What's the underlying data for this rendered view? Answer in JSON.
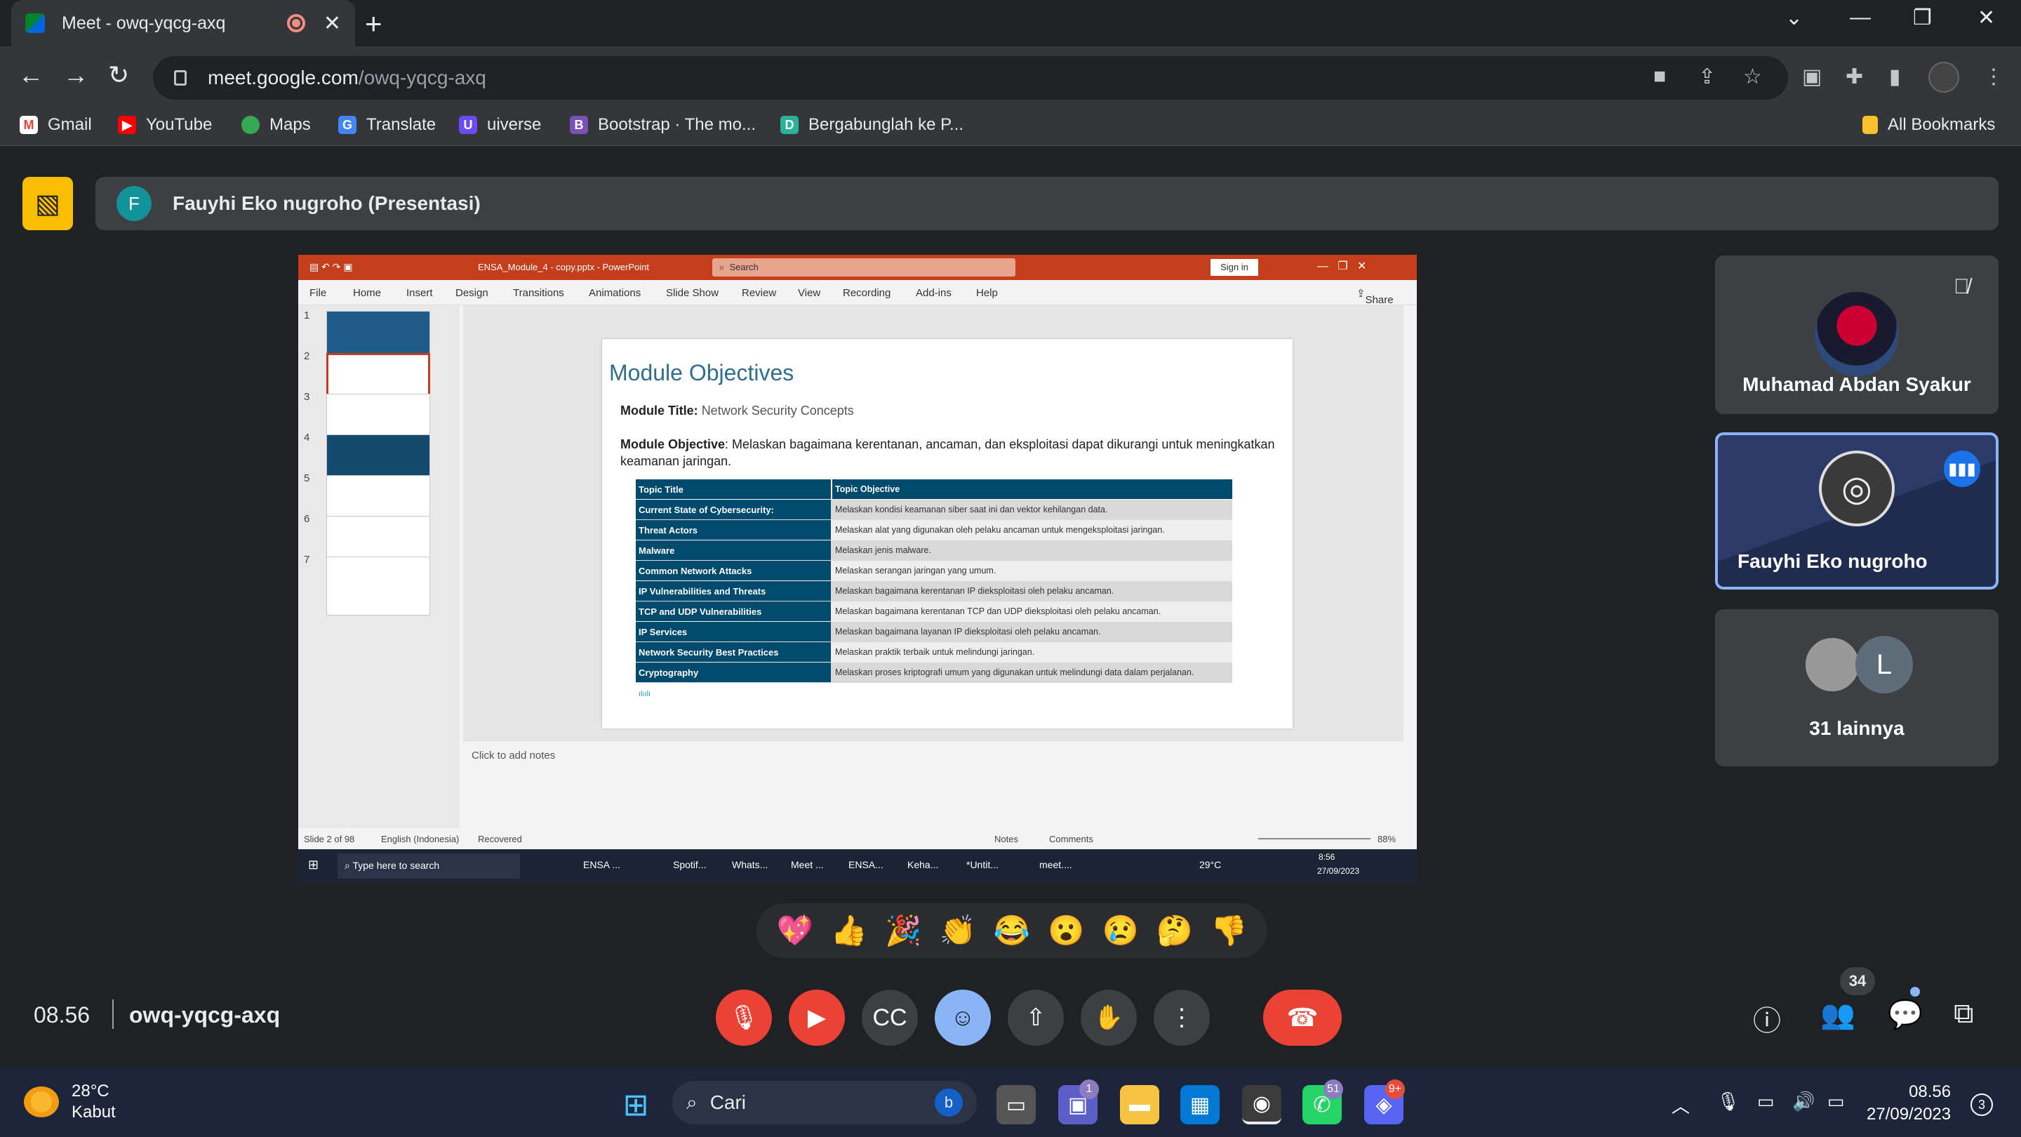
{
  "browser": {
    "tab_title": "Meet - owq-yqcg-axq",
    "url_domain": "meet.google.com",
    "url_path": "/owq-yqcg-axq",
    "bookmarks": [
      "Gmail",
      "YouTube",
      "Maps",
      "Translate",
      "uiverse",
      "Bootstrap · The mo...",
      "Bergabunglah ke P..."
    ],
    "all_bookmarks": "All Bookmarks"
  },
  "meet": {
    "presenter_initial": "F",
    "presenter_label": "Fauyhi Eko nugroho (Presentasi)",
    "time": "08.56",
    "meeting_code": "owq-yqcg-axq",
    "participants_count": "34",
    "reactions": [
      "💖",
      "👍",
      "🎉",
      "👏",
      "😂",
      "😮",
      "😢",
      "🤔",
      "👎"
    ],
    "tiles": [
      {
        "name": "Muhamad Abdan Syakur",
        "muted": true
      },
      {
        "name": "Fauyhi Eko nugroho",
        "speaking": true
      },
      {
        "name": "31 lainnya",
        "initial": "L"
      }
    ]
  },
  "ppt": {
    "file": "ENSA_Module_4 - copy.pptx  -  PowerPoint",
    "search": "Search",
    "sign_in": "Sign in",
    "share": "Share",
    "menu": [
      "File",
      "Home",
      "Insert",
      "Design",
      "Transitions",
      "Animations",
      "Slide Show",
      "Review",
      "View",
      "Recording",
      "Add-ins",
      "Help"
    ],
    "slide_title": "Module Objectives",
    "module_title_label": "Module Title:",
    "module_title": "Network Security Concepts",
    "objective_label": "Module Objective",
    "objective": ": Melaskan bagaimana kerentanan, ancaman, dan eksploitasi dapat dikurangi untuk meningkatkan keamanan jaringan.",
    "table_header": [
      "Topic Title",
      "Topic Objective"
    ],
    "table_rows": [
      [
        "Current State of Cybersecurity:",
        "Melaskan kondisi keamanan siber saat ini dan vektor kehilangan data."
      ],
      [
        "Threat Actors",
        "Melaskan alat yang digunakan oleh pelaku ancaman untuk mengeksploitasi jaringan."
      ],
      [
        "Malware",
        "Melaskan jenis malware."
      ],
      [
        "Common Network Attacks",
        "Melaskan serangan jaringan yang umum."
      ],
      [
        "IP Vulnerabilities and Threats",
        "Melaskan bagaimana kerentanan IP dieksploitasi oleh pelaku ancaman."
      ],
      [
        "TCP and UDP Vulnerabilities",
        "Melaskan bagaimana kerentanan TCP dan UDP dieksploitasi oleh pelaku ancaman."
      ],
      [
        "IP Services",
        "Melaskan bagaimana layanan IP dieksploitasi oleh pelaku ancaman."
      ],
      [
        "Network Security Best Practices",
        "Melaskan praktik terbaik untuk melindungi jaringan."
      ],
      [
        "Cryptography",
        "Melaskan proses kriptografi umum yang digunakan untuk melindungi data dalam perjalanan."
      ]
    ],
    "thumb_numbers": [
      "1",
      "2",
      "3",
      "4",
      "5",
      "6",
      "7"
    ],
    "notes": "Click to add notes",
    "status_slide": "Slide 2 of 98",
    "status_lang": "English (Indonesia)",
    "status_recovered": "Recovered",
    "status_notes": "Notes",
    "status_comments": "Comments",
    "zoom": "88%",
    "inner_search": "Type here to search",
    "inner_apps": [
      "ENSA ...",
      "Spotif...",
      "Whats...",
      "Meet ...",
      "ENSA...",
      "Keha...",
      "*Untit...",
      "meet...."
    ],
    "inner_temp": "29°C",
    "inner_time": "8:56",
    "inner_date": "27/09/2023"
  },
  "windows": {
    "temp": "28°C",
    "weather": "Kabut",
    "search": "Cari",
    "time": "08.56",
    "date": "27/09/2023",
    "notif_count": "3",
    "badge_teams": "1",
    "badge_whatsapp": "51",
    "badge_discord": "9+"
  }
}
